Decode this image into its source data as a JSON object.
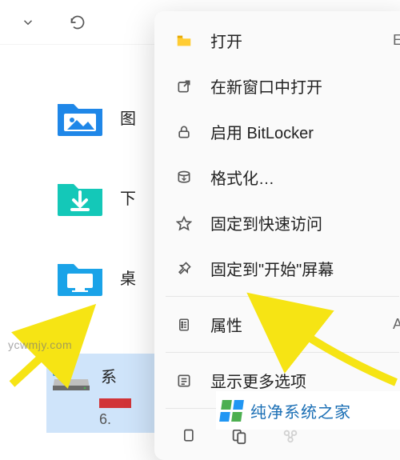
{
  "toolbar": {
    "icons": [
      "chevron-down",
      "refresh"
    ]
  },
  "items": [
    {
      "label": "图",
      "icon": "pictures"
    },
    {
      "label": "下",
      "icon": "downloads"
    },
    {
      "label": "桌",
      "icon": "desktop"
    }
  ],
  "drive": {
    "label": "系",
    "sub": "6."
  },
  "menu": {
    "items": [
      {
        "icon": "folder-open",
        "label": "打开",
        "accel": "E"
      },
      {
        "icon": "open-new-window",
        "label": "在新窗口中打开"
      },
      {
        "icon": "bitlocker",
        "label": "启用 BitLocker"
      },
      {
        "icon": "format",
        "label": "格式化…"
      },
      {
        "icon": "star",
        "label": "固定到快速访问"
      },
      {
        "icon": "pin",
        "label": "固定到\"开始\"屏幕"
      },
      {
        "icon": "properties",
        "label": "属性",
        "accel": "A"
      },
      {
        "icon": "more",
        "label": "显示更多选项"
      }
    ],
    "iconbar": [
      "copy",
      "paste",
      "share"
    ]
  },
  "watermark": "ycwmjy.com",
  "brand": "纯净系统之家"
}
